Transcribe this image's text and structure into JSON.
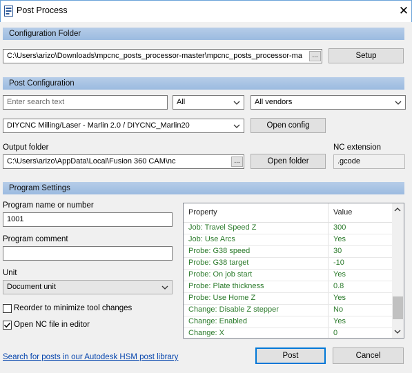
{
  "window": {
    "title": "Post Process"
  },
  "config_folder": {
    "heading": "Configuration Folder",
    "path": "C:\\Users\\arizo\\Downloads\\mpcnc_posts_processor-master\\mpcnc_posts_processor-ma",
    "browse_label": "...",
    "setup_label": "Setup"
  },
  "post_config": {
    "heading": "Post Configuration",
    "search_placeholder": "Enter search text",
    "filter_all": "All",
    "vendor_filter": "All vendors",
    "selected_post": "DIYCNC Milling/Laser - Marlin 2.0 / DIYCNC_Marlin20",
    "open_config_label": "Open config",
    "output_folder_label": "Output folder",
    "output_folder_path": "C:\\Users\\arizo\\AppData\\Local\\Fusion 360 CAM\\nc",
    "browse_label": "...",
    "open_folder_label": "Open folder",
    "nc_extension_label": "NC extension",
    "nc_extension_value": ".gcode"
  },
  "program_settings": {
    "heading": "Program Settings",
    "program_name_label": "Program name or number",
    "program_name_value": "1001",
    "program_comment_label": "Program comment",
    "program_comment_value": "",
    "unit_label": "Unit",
    "unit_value": "Document unit",
    "reorder_label": "Reorder to minimize tool changes",
    "reorder_checked": false,
    "open_nc_label": "Open NC file in editor",
    "open_nc_checked": true
  },
  "properties": {
    "header_property": "Property",
    "header_value": "Value",
    "rows": [
      {
        "property": "Job: Travel Speed Z",
        "value": "300"
      },
      {
        "property": "Job: Use Arcs",
        "value": "Yes"
      },
      {
        "property": "Probe: G38 speed",
        "value": "30"
      },
      {
        "property": "Probe: G38 target",
        "value": "-10"
      },
      {
        "property": "Probe: On job start",
        "value": "Yes"
      },
      {
        "property": "Probe: Plate thickness",
        "value": "0.8"
      },
      {
        "property": "Probe: Use Home Z",
        "value": "Yes"
      },
      {
        "property": "Change: Disable Z stepper",
        "value": "No"
      },
      {
        "property": "Change: Enabled",
        "value": "Yes"
      },
      {
        "property": "Change: X",
        "value": "0"
      }
    ],
    "text_color": "#2a7a2a"
  },
  "footer": {
    "library_link": "Search for posts in our Autodesk HSM post library",
    "post_label": "Post",
    "cancel_label": "Cancel"
  }
}
